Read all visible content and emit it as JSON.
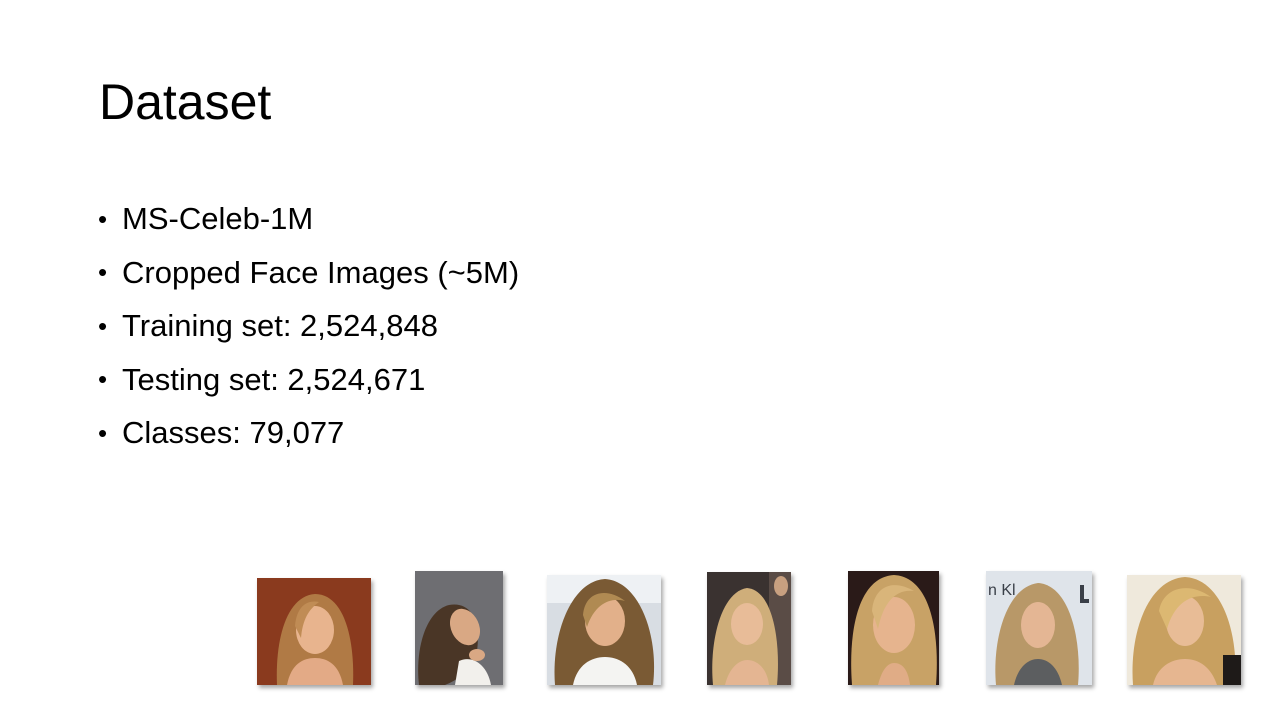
{
  "slide": {
    "title": "Dataset",
    "bullets": [
      "MS-Celeb-1M",
      "Cropped Face Images (~5M)",
      "Training set: 2,524,848",
      "Testing set: 2,524,671",
      "Classes: 79,077"
    ],
    "bullet_symbol": "•",
    "photo_backgrounds": [
      "#8a3a1e",
      "#6e6e72",
      "#d8dde3",
      "#3a3230",
      "#2a1a18",
      "#dfe4ea",
      "#efe9dc"
    ],
    "photo_background_text": "n Kl"
  }
}
